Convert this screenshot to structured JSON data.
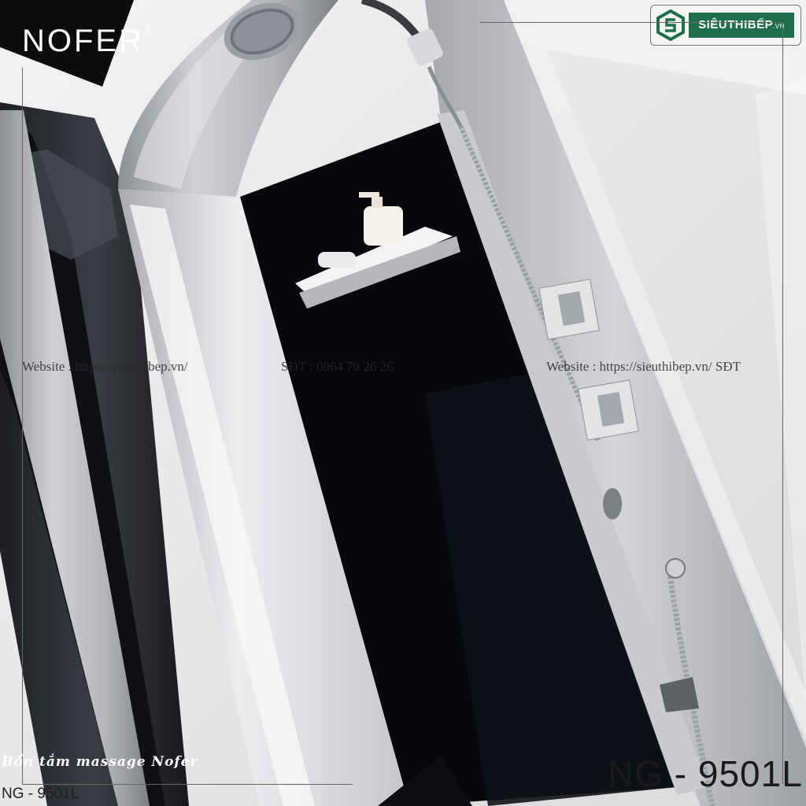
{
  "brand": {
    "name": "NOFER",
    "mark": "®"
  },
  "store_logo": {
    "text": "SIÊUTHIBẾP",
    "suffix": ".VN"
  },
  "watermark": {
    "left": "Website : https://sieuthibep.vn/",
    "middle": "SĐT : 0964 79 26 26",
    "right": "Website : https://sieuthibep.vn/ SĐT"
  },
  "caption": "Bồn tắm massage Nofer",
  "model": {
    "small": "NG - 9501L",
    "large": "NG - 9501L"
  },
  "colors": {
    "panel_silver": "#b9bbbf",
    "cabin_black": "#0a0b10",
    "logo_green": "#1d6f4c",
    "background": "#e9e9ea"
  },
  "icons": [
    "shower-head-icon",
    "handheld-shower-icon",
    "valve-knob-icon",
    "soap-dispenser-icon",
    "logo-mark-icon"
  ]
}
